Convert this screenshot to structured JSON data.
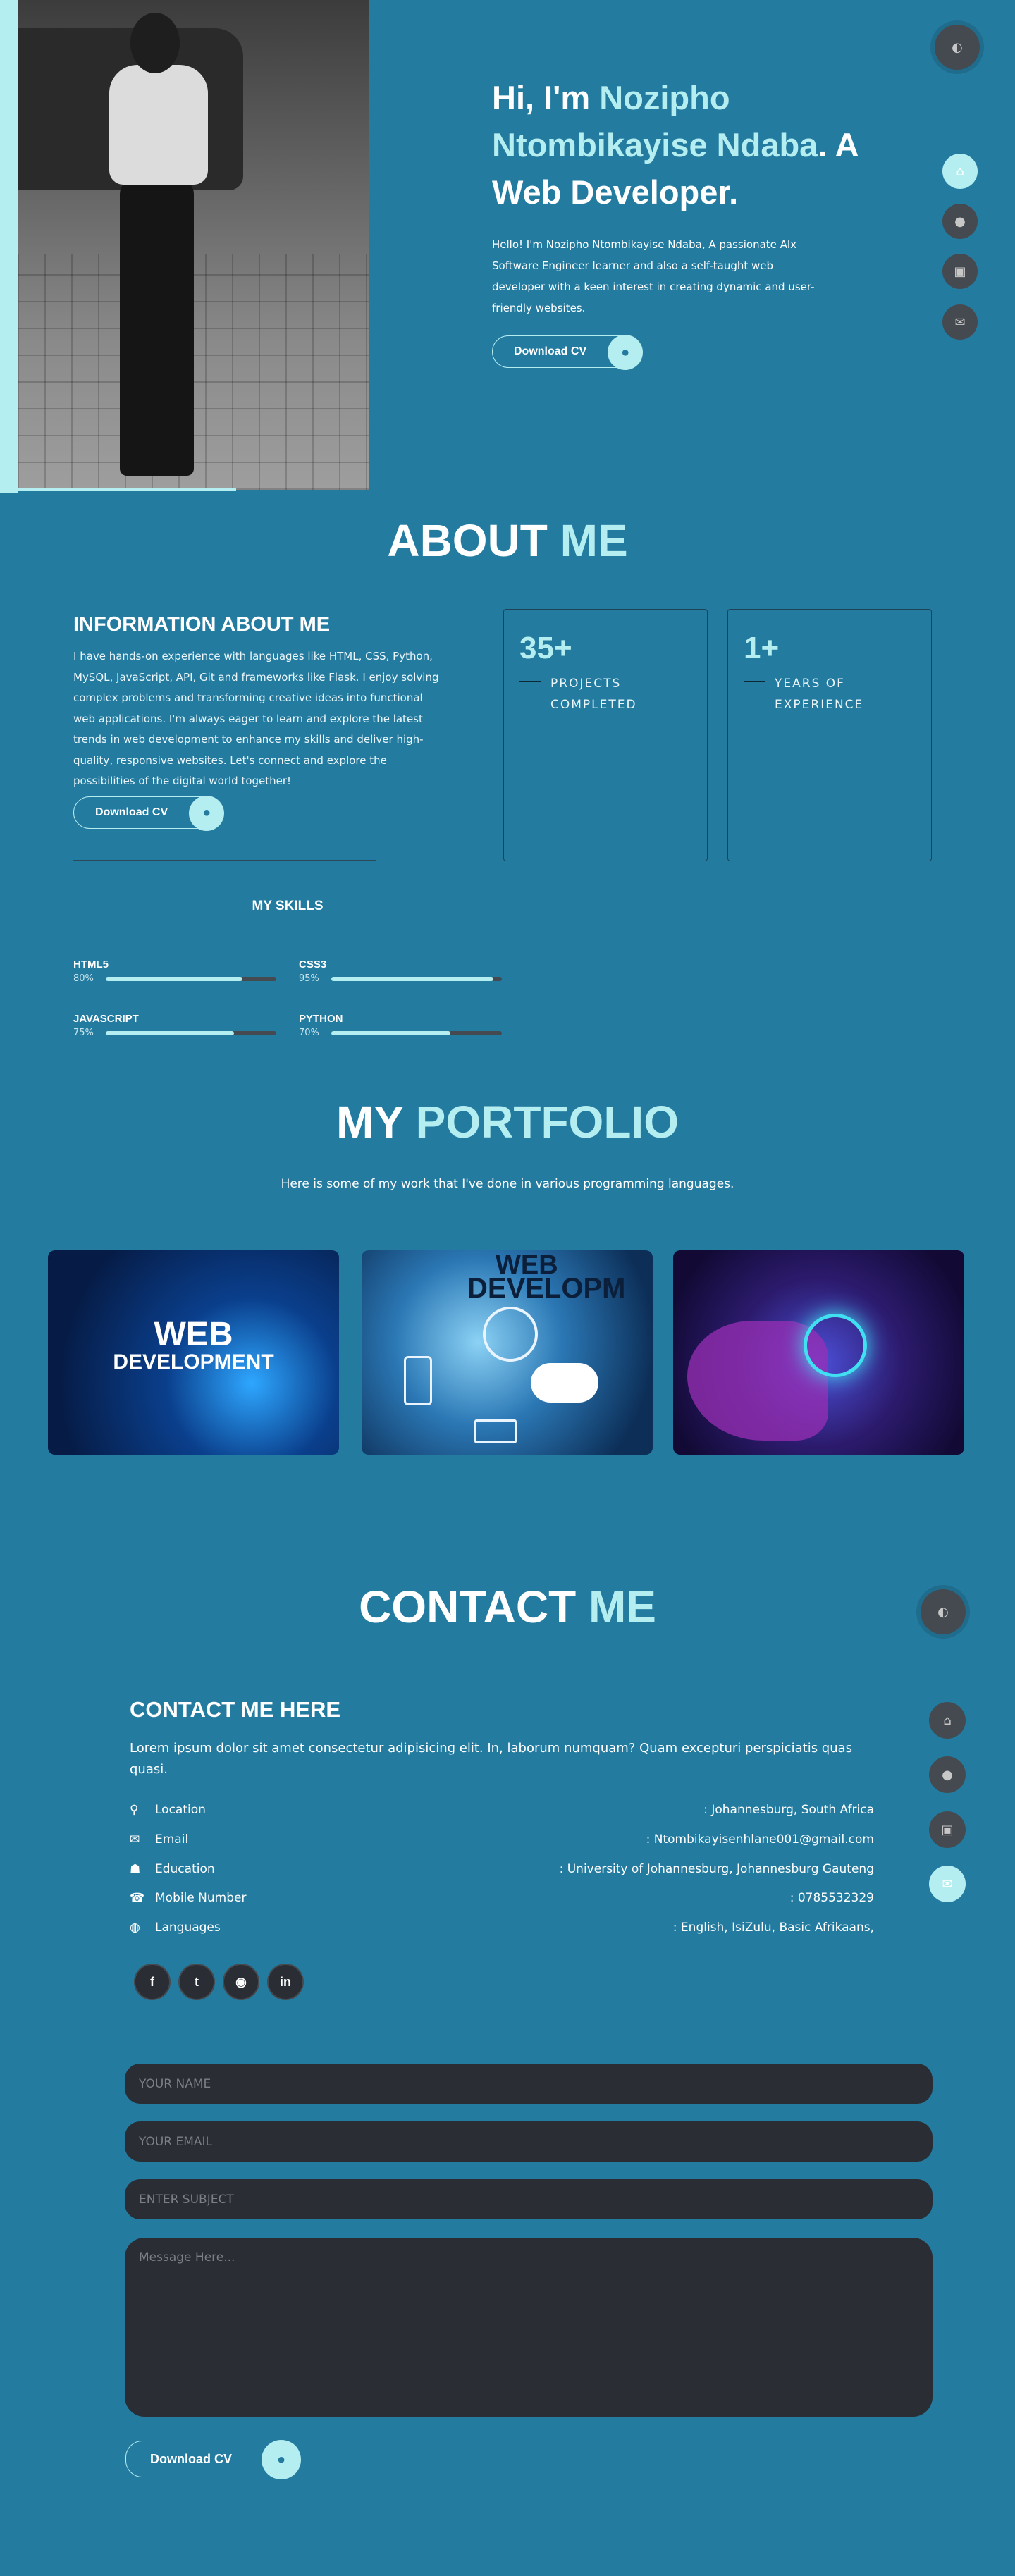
{
  "hero": {
    "greeting": "Hi, I'm ",
    "name": "Nozipho Ntombikayise Ndaba",
    "suffix": ". A Web Developer.",
    "description": "Hello! I'm Nozipho Ntombikayise Ndaba, A passionate Alx Software Engineer learner and also a self-taught web developer with a keen interest in creating dynamic and user-friendly websites.",
    "cv_button": "Download CV",
    "cv_icon": "download-icon"
  },
  "nav": {
    "theme_icon": "contrast-icon",
    "items": [
      {
        "icon": "home-icon",
        "glyph": "⌂"
      },
      {
        "icon": "user-icon",
        "glyph": "●"
      },
      {
        "icon": "briefcase-icon",
        "glyph": "▣"
      },
      {
        "icon": "envelope-icon",
        "glyph": "✉"
      }
    ]
  },
  "about": {
    "title_main": "ABOUT ",
    "title_accent": "ME",
    "info_heading": "INFORMATION ABOUT ME",
    "info_text": "I have hands-on experience with languages like HTML, CSS, Python, MySQL, JavaScript, API, Git and frameworks like Flask. I enjoy solving complex problems and transforming creative ideas into functional web applications. I'm always eager to learn and explore the latest trends in web development to enhance my skills and deliver high-quality, responsive websites. Let's connect and explore the possibilities of the digital world together!",
    "cv_button": "Download CV",
    "stats": [
      {
        "number": "35+",
        "label_line1": "PROJECTS",
        "label_line2": "COMPLETED"
      },
      {
        "number": "1+",
        "label_line1": "YEARS OF",
        "label_line2": "EXPERIENCE"
      }
    ],
    "skills_title": "MY SKILLS",
    "skills": [
      {
        "name": "HTML5",
        "percent_label": "80%",
        "level": 80
      },
      {
        "name": "CSS3",
        "percent_label": "95%",
        "level": 95
      },
      {
        "name": "JAVASCRIPT",
        "percent_label": "75%",
        "level": 75
      },
      {
        "name": "PYTHON",
        "percent_label": "70%",
        "level": 70
      }
    ]
  },
  "portfolio": {
    "title_main": "MY ",
    "title_accent": "PORTFOLIO",
    "subtitle": "Here is some of my work that I've done in various programming languages.",
    "cards": [
      {
        "line1": "WEB",
        "line2": "DEVELOPMENT"
      },
      {
        "line1": "WEB",
        "line2": "DEVELOPM"
      },
      {
        "line1": "",
        "line2": ""
      }
    ]
  },
  "contact": {
    "title_main": "CONTACT ",
    "title_accent": "ME",
    "heading": "CONTACT ME HERE",
    "description": "Lorem ipsum dolor sit amet consectetur adipisicing elit. In, laborum numquam? Quam excepturi perspiciatis quas quasi.",
    "info": [
      {
        "icon": "map-pin-icon",
        "glyph": "⚲",
        "label": "Location",
        "value": ": Johannesburg, South Africa"
      },
      {
        "icon": "envelope-icon",
        "glyph": "✉",
        "label": "Email",
        "value": ": Ntombikayisenhlane001@gmail.com"
      },
      {
        "icon": "graduation-icon",
        "glyph": "☗",
        "label": "Education",
        "value": ": University of Johannesburg, Johannesburg Gauteng"
      },
      {
        "icon": "phone-icon",
        "glyph": "☎",
        "label": "Mobile Number",
        "value": ": 0785532329"
      },
      {
        "icon": "globe-icon",
        "glyph": "◍",
        "label": "Languages",
        "value": ": English, IsiZulu, Basic Afrikaans,"
      }
    ],
    "socials": [
      {
        "icon": "facebook-icon",
        "glyph": "f"
      },
      {
        "icon": "twitter-icon",
        "glyph": "t"
      },
      {
        "icon": "github-icon",
        "glyph": "◉"
      },
      {
        "icon": "linkedin-icon",
        "glyph": "in"
      }
    ],
    "form": {
      "name_placeholder": "YOUR NAME",
      "email_placeholder": "YOUR EMAIL",
      "subject_placeholder": "ENTER SUBJECT",
      "message_placeholder": "Message Here...",
      "submit_button": "Download CV"
    }
  },
  "colors": {
    "background": "#247ba0",
    "accent": "#b5eef0",
    "dark": "#2a2d33",
    "nav_circle": "#454a50"
  }
}
